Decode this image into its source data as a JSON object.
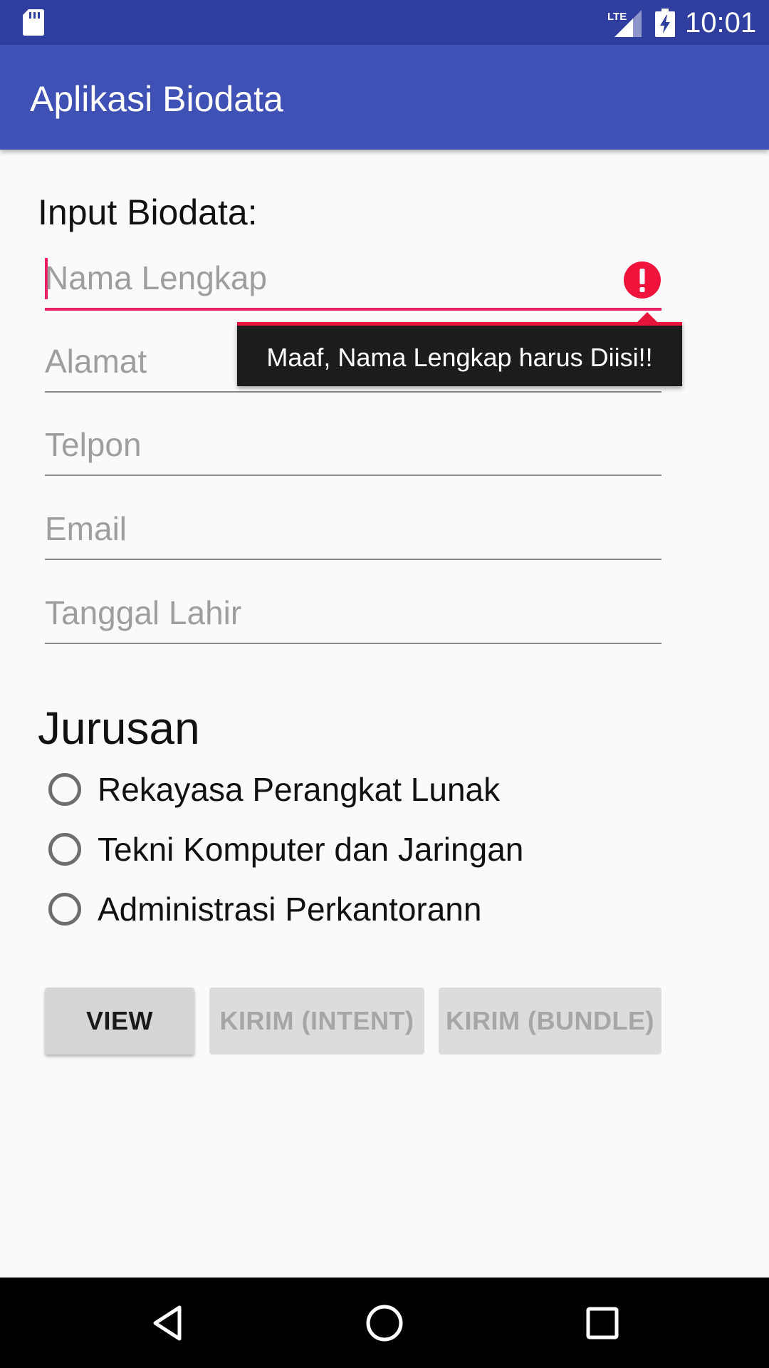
{
  "status_bar": {
    "time": "10:01",
    "network_label": "LTE",
    "icons": [
      "sd-card-icon",
      "lte-signal-icon",
      "battery-charging-icon"
    ]
  },
  "app_bar": {
    "title": "Aplikasi Biodata"
  },
  "form": {
    "section_title": "Input Biodata:",
    "fields": [
      {
        "placeholder": "Nama Lengkap",
        "value": "",
        "state": "error"
      },
      {
        "placeholder": "Alamat",
        "value": ""
      },
      {
        "placeholder": "Telpon",
        "value": ""
      },
      {
        "placeholder": "Email",
        "value": ""
      },
      {
        "placeholder": "Tanggal Lahir",
        "value": ""
      }
    ],
    "error_message": "Maaf, Nama Lengkap harus Diisi!!"
  },
  "jurusan": {
    "title": "Jurusan",
    "options": [
      {
        "label": "Rekayasa Perangkat Lunak",
        "checked": false
      },
      {
        "label": "Tekni Komputer dan Jaringan",
        "checked": false
      },
      {
        "label": "Administrasi Perkantorann",
        "checked": false
      }
    ]
  },
  "buttons": {
    "view": "VIEW",
    "kirim_intent": "KIRIM (INTENT)",
    "kirim_bundle": "KIRIM (BUNDLE)"
  },
  "colors": {
    "status_bar": "#303f9f",
    "app_bar": "#3f51b5",
    "error_accent": "#e91e63",
    "error_icon": "#f0143c"
  },
  "nav_bar": {
    "icons": [
      "back-icon",
      "home-icon",
      "recents-icon"
    ]
  }
}
